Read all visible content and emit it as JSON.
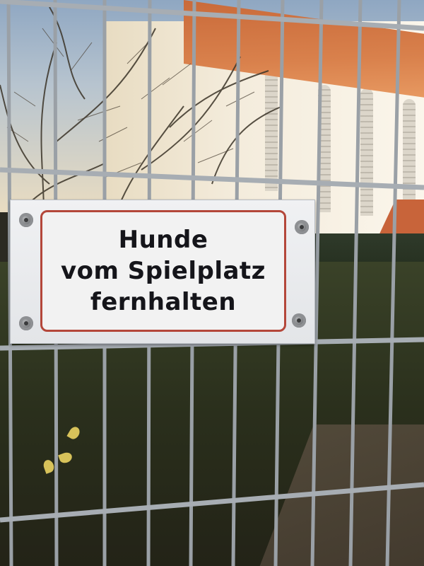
{
  "sign": {
    "lines": [
      "Hunde",
      "vom Spielplatz",
      "fernhalten"
    ]
  },
  "colors": {
    "sign_background": "#f2f2f2",
    "sign_border": "#b4473a",
    "sign_text": "#15151a",
    "fence": "#9aa0a6",
    "building": "#f4ecdc",
    "roof": "#c96a3a",
    "lawn": "#2e3320"
  }
}
